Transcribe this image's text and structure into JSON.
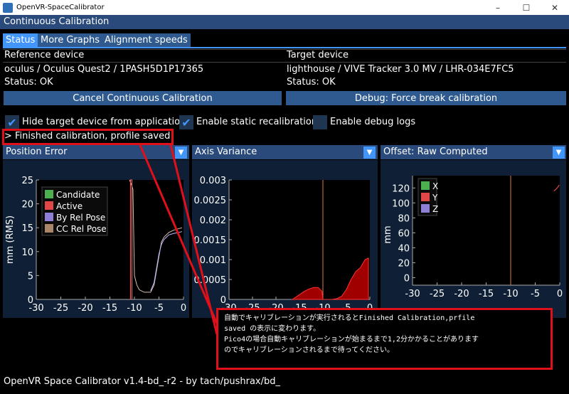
{
  "window": {
    "title": "OpenVR-SpaceCalibrator",
    "minimize": "–",
    "maximize": "☐",
    "close": "✕"
  },
  "imgui_title": "Continuous Calibration",
  "tabs": [
    "Status",
    "More Graphs",
    "Alignment speeds"
  ],
  "reference": {
    "header": "Reference device",
    "device": "oculus / Oculus Quest2 / 1PASH5D1P17365",
    "status": "Status: OK"
  },
  "target": {
    "header": "Target device",
    "device": "lighthouse / VIVE Tracker 3.0 MV / LHR-034E7FC5",
    "status": "Status: OK"
  },
  "buttons": {
    "cancel": "Cancel Continuous Calibration",
    "debug": "Debug: Force break calibration"
  },
  "checkboxes": [
    {
      "label": "Hide target device from application",
      "checked": true
    },
    {
      "label": "Enable static recalibration",
      "checked": true
    },
    {
      "label": "Enable debug logs",
      "checked": false
    }
  ],
  "status_message": "> Finished calibration, profile saved",
  "panels": [
    "Position Error",
    "Axis Variance",
    "Offset: Raw Computed"
  ],
  "callout_lines": [
    "自動でキャリブレーションが実行されるとFinished Calibration,prfile",
    "saved の表示に変わります。",
    "Pico4の場合自動キャリブレーションが始まるまで1,2分かかることがあります",
    "のでキャリブレーションされるまで待ってください。"
  ],
  "footer": "OpenVR Space Calibrator v1.4-bd_-r2 - by tach/pushrax/bd_",
  "colors": {
    "accent": "#4296fa",
    "title_bg": "#294a7a",
    "plot_bg": "#0f1f35",
    "annotation": "#e0101a"
  },
  "chart_data": [
    {
      "type": "line",
      "title": "Position Error",
      "ylabel": "mm (RMS)",
      "xlim": [
        -30,
        0
      ],
      "ylim": [
        0,
        25
      ],
      "x_ticks": [
        -30,
        -25,
        -20,
        -15,
        -10,
        -5,
        0
      ],
      "y_ticks": [
        0,
        5,
        10,
        15,
        20,
        25
      ],
      "legend": [
        "Candidate",
        "Active",
        "By Rel Pose",
        "CC Rel Pose"
      ],
      "legend_colors": [
        "#4caf50",
        "#e04848",
        "#8f7fd6",
        "#a9866a"
      ],
      "series": [
        {
          "name": "CC Rel Pose",
          "x": [
            -11,
            -10.6,
            -10.3,
            -10,
            -9.5,
            -9,
            -8,
            -6.7,
            -6,
            -5.5,
            -5,
            -4.5,
            -4,
            -3.5,
            -3,
            -2,
            -1,
            -0.3
          ],
          "y": [
            25,
            24,
            23,
            5,
            3,
            2,
            1.5,
            1.5,
            3,
            6,
            9,
            12,
            13,
            13.5,
            14,
            14.5,
            14.8,
            15
          ]
        },
        {
          "name": "By Rel Pose",
          "x": [
            -6.7,
            -6,
            -5.5,
            -5,
            -4.5,
            -4,
            -3.5,
            -3,
            -2,
            -1,
            -0.3
          ],
          "y": [
            1.8,
            3.5,
            6.5,
            9.5,
            11.5,
            12.5,
            13,
            13.5,
            13.8,
            14,
            14.2
          ]
        },
        {
          "name": "Active",
          "x": [
            -10.8,
            -10.8,
            -10.5,
            -10.5
          ],
          "y": [
            0,
            25,
            25,
            0
          ]
        }
      ]
    },
    {
      "type": "area",
      "title": "Axis Variance",
      "xlim": [
        -30,
        0
      ],
      "ylim": [
        0,
        0.003
      ],
      "x_ticks": [
        -30,
        -25,
        -20,
        -15,
        -10,
        -5,
        0
      ],
      "y_ticks": [
        0,
        0.0005,
        0.001,
        0.0015,
        0.002,
        0.0025,
        0.003
      ],
      "y_tick_labels": [
        "0",
        "0.0005",
        "0.001",
        "0.0015",
        "0.002",
        "0.0025",
        "0.003"
      ],
      "marker_x": -10,
      "x": [
        -16.5,
        -16,
        -15,
        -14,
        -13,
        -12,
        -11,
        -10.2,
        -10,
        -9,
        -8,
        -7,
        -6,
        -5,
        -4,
        -3,
        -2,
        -1,
        -0.3
      ],
      "values": [
        0,
        4e-05,
        0.00012,
        0.0002,
        0.00026,
        0.0003,
        0.0003,
        0.0002,
        0,
        0,
        0,
        2e-05,
        8e-05,
        0.00025,
        0.0005,
        0.0007,
        0.0008,
        0.001,
        0.00104
      ]
    },
    {
      "type": "line",
      "title": "Offset: Raw Computed",
      "ylabel": "mm",
      "xlim": [
        -30,
        0
      ],
      "ylim": [
        -10,
        125
      ],
      "x_ticks": [
        -30,
        -25,
        -20,
        -15,
        -10,
        -5,
        0
      ],
      "y_ticks": [
        0,
        20,
        40,
        60,
        80,
        100,
        120
      ],
      "legend": [
        "X",
        "Y",
        "Z"
      ],
      "legend_colors": [
        "#4caf50",
        "#e04848",
        "#8f7fd6"
      ],
      "marker_x": -10,
      "series": [
        {
          "name": "Y",
          "x": [
            -1.2,
            -0.8,
            -0.4,
            -0.1
          ],
          "y": [
            116,
            118,
            121,
            124
          ]
        }
      ]
    }
  ]
}
